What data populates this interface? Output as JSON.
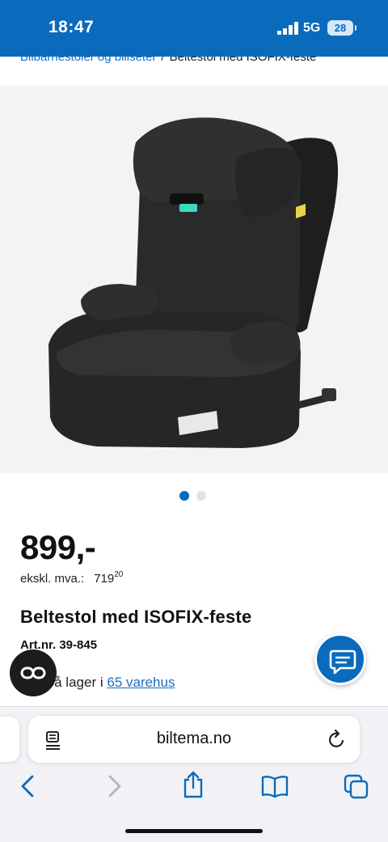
{
  "status_bar": {
    "time": "18:47",
    "network": "5G",
    "battery": "28"
  },
  "breadcrumb": {
    "parent": "Bilbarnestoler og biliseter",
    "separator": "/",
    "current": "Beltestol med ISOFIX-feste"
  },
  "gallery": {
    "image_icon": "car-booster-seat-image",
    "total_images": 2,
    "active_index": 1
  },
  "product": {
    "price": "899,-",
    "ex_vat_label": "ekskl. mva.:",
    "ex_vat_main": "719",
    "ex_vat_decimals": "20",
    "title": "Beltestol med ISOFIX-feste",
    "article_number": "Art.nr. 39-845",
    "stock_prefix": "Finnes på lager i",
    "stock_visible_prefix": "es på lager i",
    "stock_link": "65 varehus"
  },
  "floating": {
    "loop_icon": "infinity-loop-icon",
    "chat_icon": "chat-bubble-icon"
  },
  "browser": {
    "url": "biltema.no",
    "toolbar": [
      "back",
      "forward",
      "share",
      "bookmarks",
      "tabs"
    ]
  },
  "colors": {
    "brand_blue": "#0a6bbd",
    "link_blue": "#1a6fc2"
  }
}
